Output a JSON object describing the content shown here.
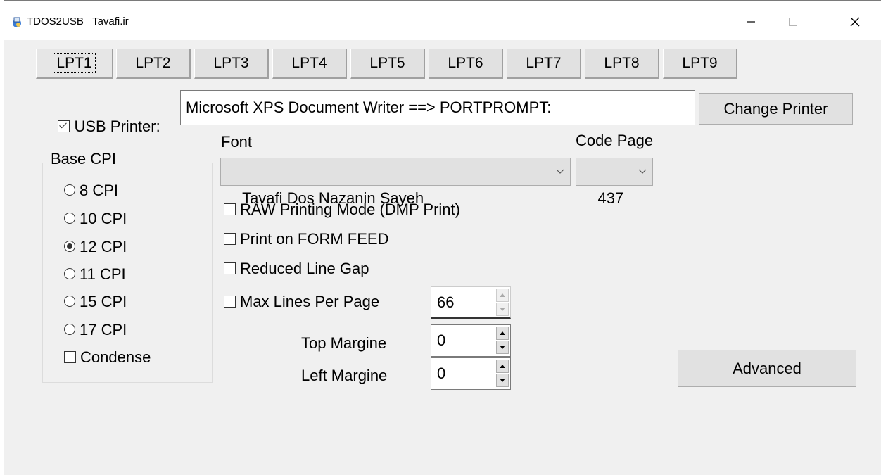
{
  "window": {
    "title": "TDOS2USB   Tavafi.ir",
    "icon": "printer-app-icon",
    "controls": [
      "minimize-icon",
      "maximize-icon",
      "close-icon"
    ]
  },
  "tabs": [
    {
      "label": "LPT1",
      "active": true
    },
    {
      "label": "LPT2"
    },
    {
      "label": "LPT3"
    },
    {
      "label": "LPT4"
    },
    {
      "label": "LPT5"
    },
    {
      "label": "LPT6"
    },
    {
      "label": "LPT7"
    },
    {
      "label": "LPT8"
    },
    {
      "label": "LPT9"
    }
  ],
  "usb": {
    "checkbox_label": "USB Printer:",
    "checked": true,
    "printer_value": "Microsoft XPS Document Writer ==> PORTPROMPT:",
    "change_button": "Change Printer"
  },
  "base_cpi": {
    "label": "Base CPI",
    "options": [
      {
        "label": "8 CPI",
        "selected": false
      },
      {
        "label": "10 CPI",
        "selected": false
      },
      {
        "label": "12 CPI",
        "selected": true
      },
      {
        "label": "11 CPI",
        "selected": false
      },
      {
        "label": "15 CPI",
        "selected": false
      },
      {
        "label": "17 CPI",
        "selected": false
      }
    ],
    "condense_label": "Condense",
    "condense_checked": false
  },
  "font": {
    "label": "Font",
    "selected": "Tavafi Dos Nazanin Sayeh"
  },
  "code_page": {
    "label": "Code Page",
    "selected": "437"
  },
  "options": {
    "raw_mode": "RAW Printing Mode (DMP Print)",
    "form_feed": "Print on FORM FEED",
    "reduced_gap": "Reduced Line Gap",
    "max_lines": "Max Lines Per Page",
    "max_lines_value": "66"
  },
  "margins": {
    "top_label": "Top Margine",
    "top_value": "0",
    "left_label": "Left Margine",
    "left_value": "0"
  },
  "advanced_button": "Advanced"
}
